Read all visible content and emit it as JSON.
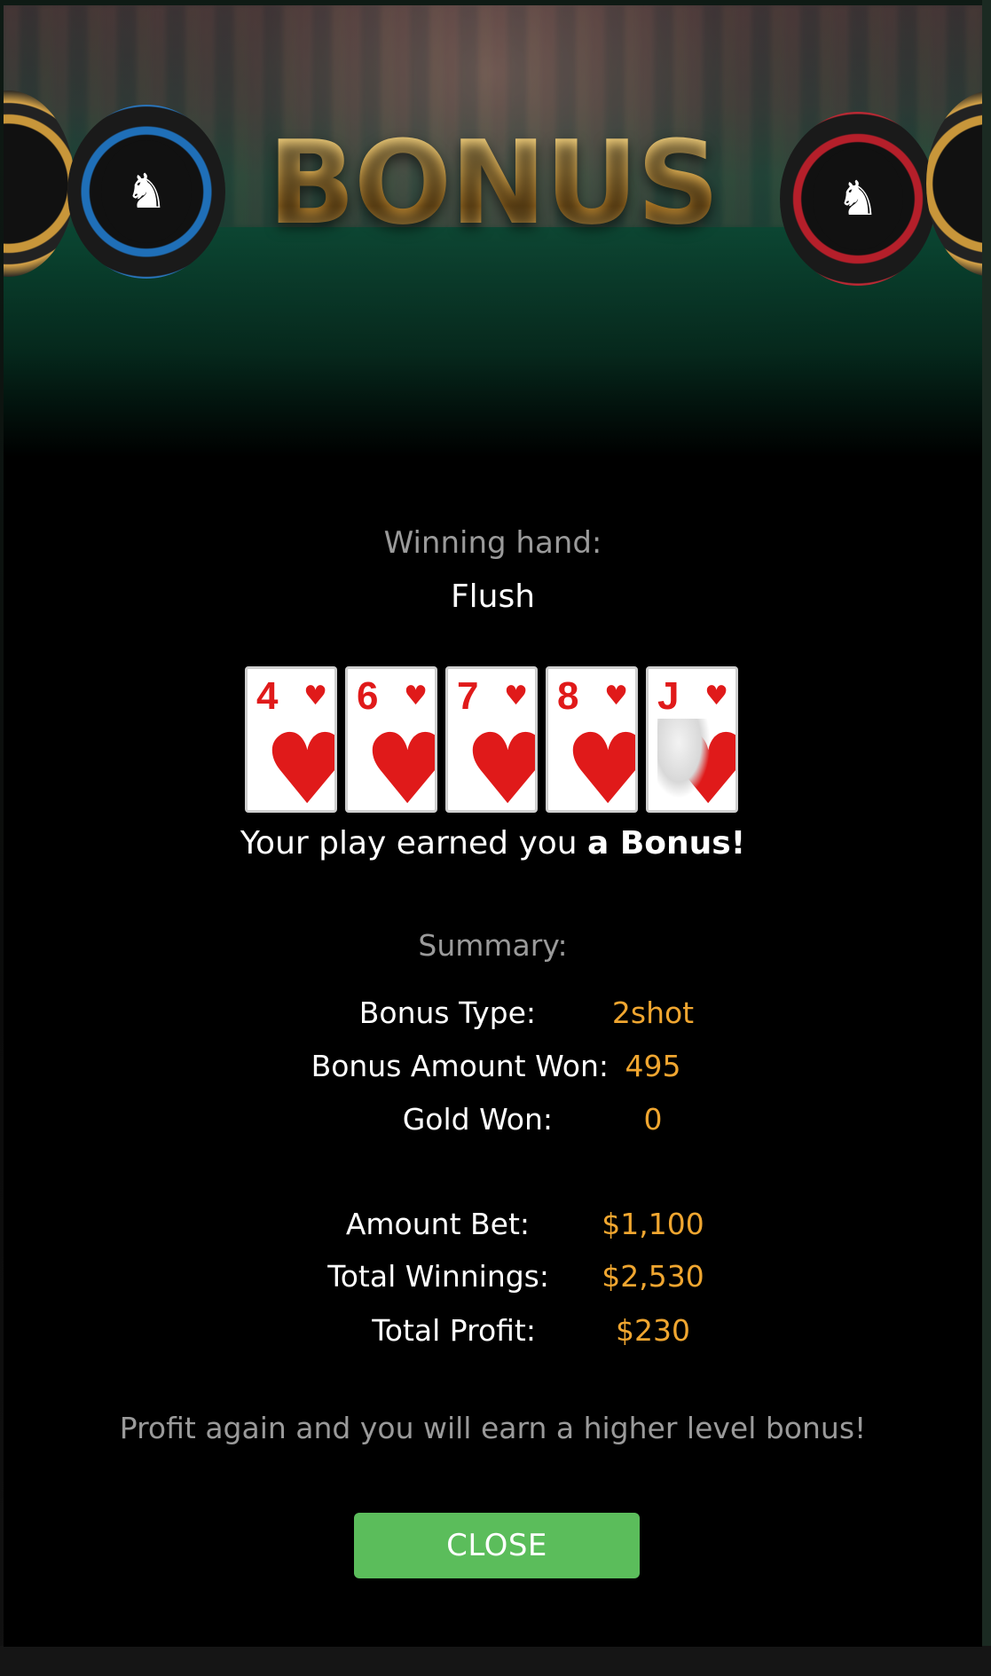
{
  "banner": {
    "title": "BONUS",
    "chip_icons": [
      "horse-emblem-icon",
      "horse-emblem-icon"
    ],
    "colors": {
      "gold": "#e5b455",
      "felt": "#0c3f2e"
    }
  },
  "hand": {
    "label": "Winning hand:",
    "value": "Flush",
    "cards": [
      {
        "rank": "4",
        "suit": "♥"
      },
      {
        "rank": "6",
        "suit": "♥"
      },
      {
        "rank": "7",
        "suit": "♥"
      },
      {
        "rank": "8",
        "suit": "♥"
      },
      {
        "rank": "J",
        "suit": "♥"
      }
    ]
  },
  "earned": {
    "prefix": "Your play earned you ",
    "bold": "a Bonus!"
  },
  "summary": {
    "label": "Summary:",
    "bonus_type_label": "Bonus Type:",
    "bonus_type_value": "2shot",
    "bonus_amount_label": "Bonus Amount Won:",
    "bonus_amount_value": "495",
    "gold_won_label": "Gold Won:",
    "gold_won_value": "0",
    "amount_bet_label": "Amount Bet:",
    "amount_bet_value": "$1,100",
    "total_winnings_label": "Total Winnings:",
    "total_winnings_value": "$2,530",
    "total_profit_label": "Total Profit:",
    "total_profit_value": "$230"
  },
  "footer_note": "Profit again and you will earn a higher level bonus!",
  "close_label": "CLOSE",
  "colors": {
    "value_accent": "#f0a630",
    "button": "#5bbd5b"
  }
}
